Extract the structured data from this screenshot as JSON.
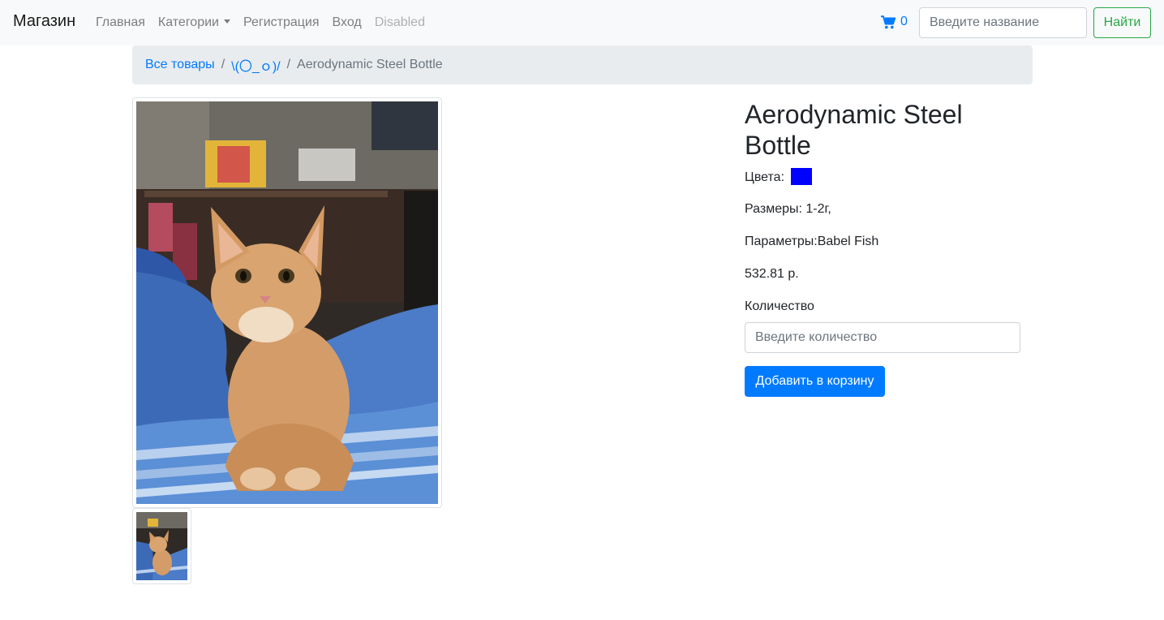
{
  "navbar": {
    "brand": "Магазин",
    "links": [
      "Главная",
      "Категории",
      "Регистрация",
      "Вход",
      "Disabled"
    ],
    "cart_count": "0",
    "search_placeholder": "Введите название",
    "search_button": "Найти"
  },
  "breadcrumb": {
    "items": [
      "Все товары",
      "\\(〇_ｏ)/",
      "Aerodynamic Steel Bottle"
    ],
    "separator": "/"
  },
  "product": {
    "image_alt": "orange kitten on blue blanket",
    "title": "Aerodynamic Steel Bottle",
    "colors_label": "Цвета:",
    "color_value": "#0000ff",
    "sizes": "Размеры: 1-2г,",
    "params": "Параметры:Babel Fish",
    "price": "532.81 р.",
    "quantity_label": "Количество",
    "quantity_placeholder": "Введите количество",
    "add_to_cart": "Добавить в корзину"
  }
}
